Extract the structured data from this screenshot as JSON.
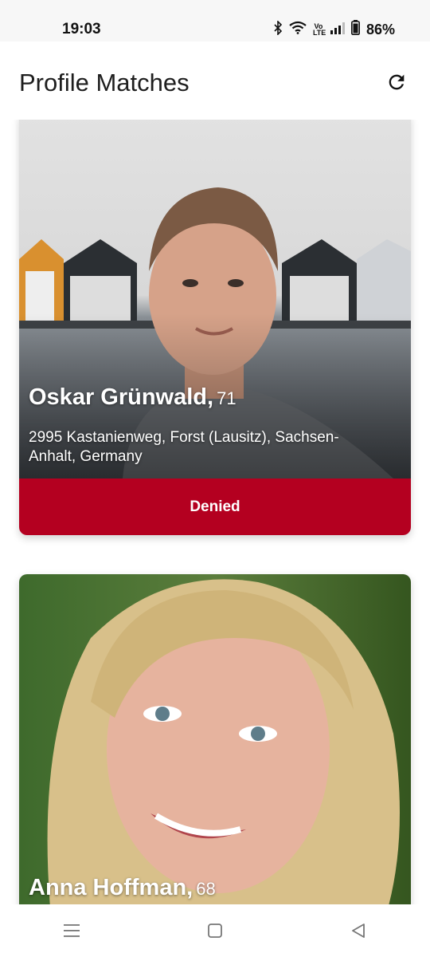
{
  "status_bar": {
    "time": "19:03",
    "icons": [
      "bluetooth-icon",
      "wifi-icon",
      "volte-icon",
      "signal-icon",
      "battery-icon"
    ],
    "volte_label": "Vo LTE",
    "battery": "86%"
  },
  "app_bar": {
    "title": "Profile Matches",
    "refresh_icon": "refresh-icon"
  },
  "profiles": [
    {
      "name": "Oskar Grünwald,",
      "age": "71",
      "address": "2995 Kastanienweg, Forst (Lausitz), Sachsen-Anhalt, Germany",
      "status": "Denied",
      "status_color": "#b40020"
    },
    {
      "name": "Anna Hoffman,",
      "age": "68"
    }
  ],
  "nav_bar": {
    "icons": [
      "menu-icon",
      "home-icon",
      "back-icon"
    ]
  }
}
